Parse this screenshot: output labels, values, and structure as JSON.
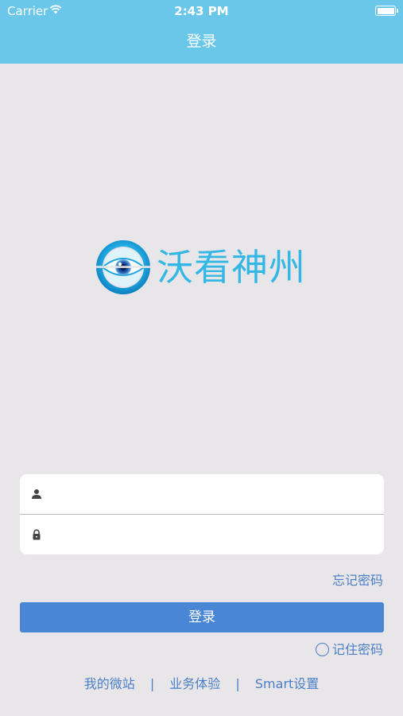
{
  "status_bar": {
    "carrier": "Carrier",
    "time": "2:43 PM",
    "battery_level": 1.0,
    "wifi_icon": "wifi-icon",
    "battery_icon": "battery-icon"
  },
  "nav": {
    "title": "登录"
  },
  "logo": {
    "text": "沃看神州",
    "icon": "eye-logo-icon",
    "color": "#35b7e6"
  },
  "form": {
    "username": {
      "icon": "user-icon",
      "value": "",
      "placeholder": ""
    },
    "password": {
      "icon": "lock-icon",
      "value": "",
      "placeholder": ""
    }
  },
  "forgot_password": "忘记密码",
  "login_button": "登录",
  "remember_password": {
    "label": "记住密码",
    "checked": false
  },
  "footer": {
    "links": [
      "我的微站",
      "业务体验",
      "Smart设置"
    ],
    "separator": "|"
  },
  "colors": {
    "header": "#6ac7ea",
    "background": "#e8e6e8",
    "button": "#4a86d6",
    "link": "#4a7fc8"
  }
}
